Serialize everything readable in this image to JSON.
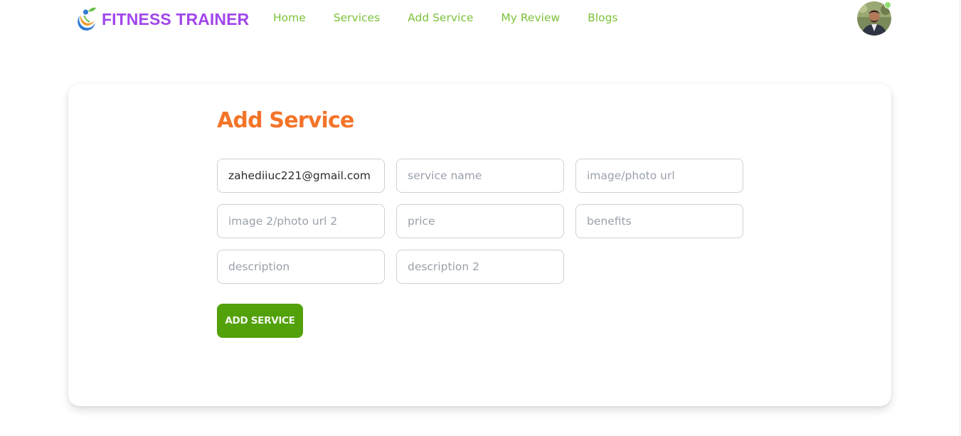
{
  "brand": {
    "name": "FITNESS TRAINER",
    "logo_icon": "fitness-figure-logo"
  },
  "nav": {
    "items": [
      {
        "label": "Home"
      },
      {
        "label": "Services"
      },
      {
        "label": "Add Service"
      },
      {
        "label": "My Review"
      },
      {
        "label": "Blogs"
      }
    ]
  },
  "user": {
    "avatar_icon": "user-avatar-photo",
    "status": "online"
  },
  "form": {
    "title": "Add Service",
    "fields": {
      "email": {
        "value": "zahediiuc221@gmail.com",
        "placeholder": ""
      },
      "service_name": {
        "value": "",
        "placeholder": "service name"
      },
      "image_url": {
        "value": "",
        "placeholder": "image/photo url"
      },
      "image_url_2": {
        "value": "",
        "placeholder": "image 2/photo url 2"
      },
      "price": {
        "value": "",
        "placeholder": "price"
      },
      "benefits": {
        "value": "",
        "placeholder": "benefits"
      },
      "description": {
        "value": "",
        "placeholder": "description"
      },
      "description_2": {
        "value": "",
        "placeholder": "description 2"
      }
    },
    "submit_label": "ADD SERVICE"
  },
  "colors": {
    "brand": "#a146ec",
    "nav_link": "#7cc23a",
    "title": "#f47428",
    "button": "#52a10a",
    "online_dot": "#8fdc6f"
  }
}
